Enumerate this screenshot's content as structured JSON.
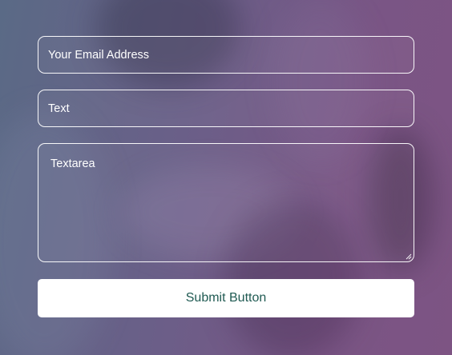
{
  "form": {
    "email_placeholder": "Your Email Address",
    "text_placeholder": "Text",
    "textarea_placeholder": "Textarea",
    "submit_label": "Submit Button"
  },
  "colors": {
    "submit_text": "#1f5a52",
    "field_border": "#ffffff",
    "field_text": "#ffffff"
  }
}
